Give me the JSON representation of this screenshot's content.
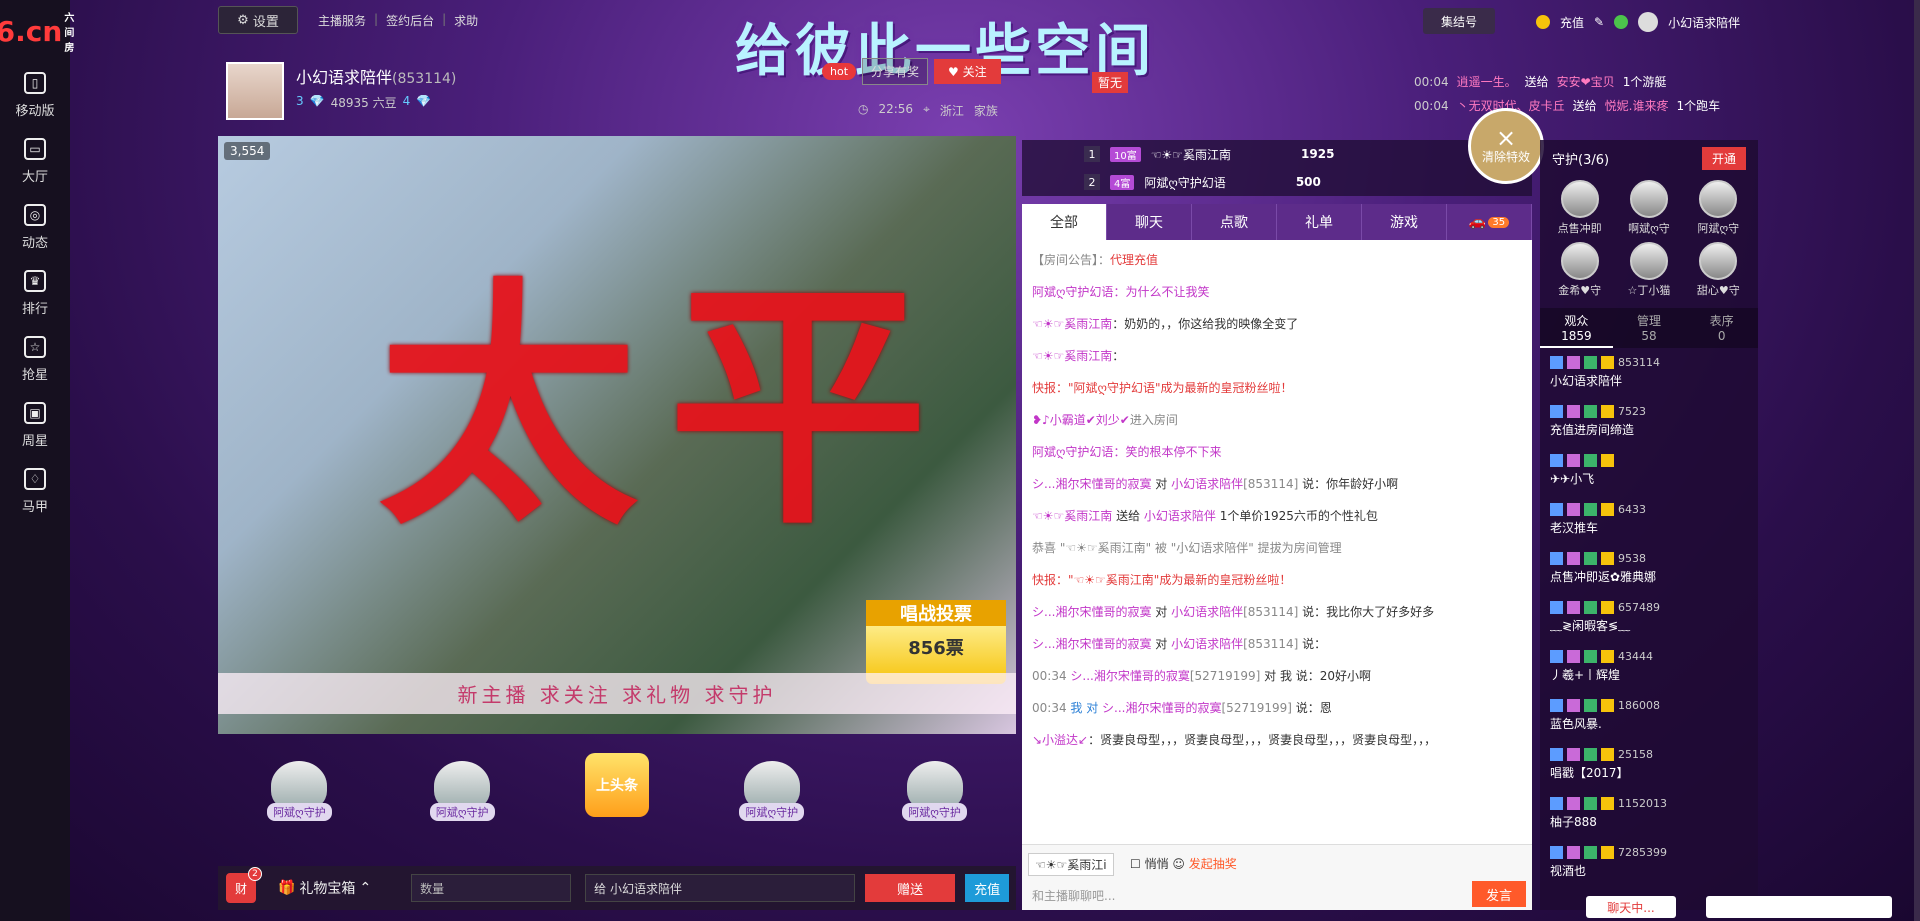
{
  "logo": {
    "text": "6.cn",
    "sub": "六间房"
  },
  "left_nav": [
    {
      "label": "移动版",
      "icon": "mobile-icon"
    },
    {
      "label": "大厅",
      "icon": "tv-icon"
    },
    {
      "label": "动态",
      "icon": "compass-icon"
    },
    {
      "label": "排行",
      "icon": "crown-icon"
    },
    {
      "label": "抢星",
      "icon": "star-icon"
    },
    {
      "label": "周星",
      "icon": "gift-icon"
    },
    {
      "label": "马甲",
      "icon": "shirt-icon"
    }
  ],
  "topbar": {
    "settings": "设置",
    "links": [
      "主播服务",
      "签约后台",
      "求助"
    ],
    "banner": "给彼此一些空间",
    "jiejiehao": "集结号",
    "recharge": "充值",
    "user": "小幻语求陪伴"
  },
  "anchor": {
    "name": "小幻语求陪伴",
    "id": "(853114)",
    "level_a": "3",
    "beans": "48935 六豆",
    "level_b": "4",
    "hot": "hot",
    "share": "分享有奖",
    "follow": "关注",
    "time": "22:56",
    "region": "浙江",
    "family": "家族",
    "flag": "暂无"
  },
  "gift_feed": [
    {
      "time": "00:04",
      "user": "逍遥一生。",
      "verb": "送给",
      "to": "安安❤宝贝",
      "item": "1个游艇"
    },
    {
      "time": "00:04",
      "user": "丶无双时代、皮卡丘",
      "verb": "送给",
      "to": "悦妮.谁来疼",
      "item": "1个跑车"
    }
  ],
  "video": {
    "viewers": "3,554",
    "gift_text": "太平",
    "vote_title": "唱战投票",
    "vote_count": "856票",
    "caption": "新主播 求关注 求礼物 求守护"
  },
  "guards_row": [
    "阿斌ღ守护",
    "阿斌ღ守护",
    "上头条",
    "阿斌ღ守护",
    "阿斌ღ守护"
  ],
  "bottom_bar": {
    "cai": "财",
    "cai_badge": "2",
    "gift_box": "礼物宝箱",
    "qty_placeholder": "数量",
    "to_label": "给 小幻语求陪伴",
    "send": "赠送",
    "charge": "充值"
  },
  "rank": [
    {
      "num": "1",
      "lv": "10富",
      "name": "☜☀☞奚雨江南",
      "amount": "1925"
    },
    {
      "num": "2",
      "lv": "4富",
      "name": "阿斌ღ守护幻语",
      "amount": "500"
    }
  ],
  "clear_effect": "清除特效",
  "chat_tabs": [
    "全部",
    "聊天",
    "点歌",
    "礼单",
    "游戏"
  ],
  "chat_car_count": "35",
  "chat_messages": [
    {
      "parts": [
        {
          "t": "【房间公告】：",
          "c": "gray"
        },
        {
          "t": "代理充值",
          "c": "red"
        }
      ]
    },
    {
      "parts": [
        {
          "t": "阿斌ღ守护幻语",
          "c": "nm"
        },
        {
          "t": "：为什么不让我笑",
          "c": "nm"
        }
      ]
    },
    {
      "parts": [
        {
          "t": "☜☀☞奚雨江南",
          "c": "nm"
        },
        {
          "t": "：奶奶的，，你这给我的映像全变了",
          "c": ""
        }
      ]
    },
    {
      "parts": [
        {
          "t": "☜☀☞奚雨江南",
          "c": "nm"
        },
        {
          "t": "：",
          "c": ""
        }
      ]
    },
    {
      "parts": [
        {
          "t": "快报：\"阿斌ღ守护幻语\"成为最新的皇冠粉丝啦！",
          "c": "red"
        }
      ]
    },
    {
      "parts": [
        {
          "t": "❥♪小霸道✔刘少✔",
          "c": "nm"
        },
        {
          "t": "进入房间",
          "c": "gray"
        }
      ]
    },
    {
      "parts": [
        {
          "t": "阿斌ღ守护幻语",
          "c": "nm"
        },
        {
          "t": "：笑的根本停不下来",
          "c": "nm"
        }
      ]
    },
    {
      "parts": [
        {
          "t": "シ...湘尔宋懂哥的寂寞",
          "c": "nm"
        },
        {
          "t": " 对 ",
          "c": ""
        },
        {
          "t": "小幻语求陪伴",
          "c": "nm"
        },
        {
          "t": "[853114]",
          "c": "gray"
        },
        {
          "t": " 说：你年龄好小啊",
          "c": ""
        }
      ]
    },
    {
      "parts": [
        {
          "t": "☜☀☞奚雨江南",
          "c": "nm"
        },
        {
          "t": " 送给 ",
          "c": ""
        },
        {
          "t": "小幻语求陪伴",
          "c": "nm"
        },
        {
          "t": " 1个单价1925六币的个性礼包",
          "c": ""
        }
      ]
    },
    {
      "parts": [
        {
          "t": "恭喜 \"☜☀☞奚雨江南\" 被 \"小幻语求陪伴\" 提拔为房间管理",
          "c": "gray"
        }
      ]
    },
    {
      "parts": [
        {
          "t": "快报：\"☜☀☞奚雨江南\"成为最新的皇冠粉丝啦！",
          "c": "red"
        }
      ]
    },
    {
      "parts": [
        {
          "t": "シ...湘尔宋懂哥的寂寞",
          "c": "nm"
        },
        {
          "t": " 对 ",
          "c": ""
        },
        {
          "t": "小幻语求陪伴",
          "c": "nm"
        },
        {
          "t": "[853114]",
          "c": "gray"
        },
        {
          "t": " 说：我比你大了好多好多",
          "c": ""
        }
      ]
    },
    {
      "parts": [
        {
          "t": "シ...湘尔宋懂哥的寂寞",
          "c": "nm"
        },
        {
          "t": " 对 ",
          "c": ""
        },
        {
          "t": "小幻语求陪伴",
          "c": "nm"
        },
        {
          "t": "[853114]",
          "c": "gray"
        },
        {
          "t": " 说：",
          "c": ""
        }
      ]
    },
    {
      "parts": [
        {
          "t": "00:34 ",
          "c": "gray"
        },
        {
          "t": "シ...湘尔宋懂哥的寂寞",
          "c": "nm"
        },
        {
          "t": "[52719199]",
          "c": "gray"
        },
        {
          "t": " 对 我 说：20好小啊",
          "c": ""
        }
      ]
    },
    {
      "parts": [
        {
          "t": "00:34 ",
          "c": "gray"
        },
        {
          "t": "我 对 ",
          "c": "ok"
        },
        {
          "t": "シ...湘尔宋懂哥的寂寞",
          "c": "nm"
        },
        {
          "t": "[52719199]",
          "c": "gray"
        },
        {
          "t": " 说：恩",
          "c": ""
        }
      ]
    },
    {
      "parts": [
        {
          "t": "↘小溢达↙",
          "c": "nm"
        },
        {
          "t": "：贤妻良母型，，，贤妻良母型，，，贤妻良母型，，，贤妻良母型，，，",
          "c": ""
        }
      ]
    }
  ],
  "chat_footer": {
    "target": "☜☀☞奚雨江i",
    "quiet": "悄悄",
    "placeholder": "和主播聊聊吧...",
    "send": "发言",
    "extra": "发起抽奖"
  },
  "right_panel": {
    "guard_title": "守护(3/6)",
    "open": "开通",
    "guards": [
      "点售冲即",
      "啊斌ღ守",
      "阿斌ღ守",
      "金希♥守",
      "☆丁小猫",
      "甜心♥守"
    ],
    "tabs": [
      {
        "label": "观众",
        "count": "1859"
      },
      {
        "label": "管理",
        "count": "58"
      },
      {
        "label": "表序",
        "count": "0"
      }
    ],
    "audience": [
      {
        "meta": "853114",
        "name": "小幻语求陪伴"
      },
      {
        "meta": "7523",
        "name": "充值进房间缔造"
      },
      {
        "meta": "",
        "name": "✈✈小飞"
      },
      {
        "meta": "6433",
        "name": "老汉推车"
      },
      {
        "meta": "9538",
        "name": "点售冲即返✿雅典娜"
      },
      {
        "meta": "657489",
        "name": "﹏≷闲暇客≶﹏"
      },
      {
        "meta": "43444",
        "name": "丿羲+丨辉煌"
      },
      {
        "meta": "186008",
        "name": "蓝色风暴."
      },
      {
        "meta": "25158",
        "name": "唱戳【2017】"
      },
      {
        "meta": "1152013",
        "name": "柚子888"
      },
      {
        "meta": "7285399",
        "name": "视酒也"
      }
    ]
  },
  "bottom_right": {
    "chat": "聊天中..."
  }
}
